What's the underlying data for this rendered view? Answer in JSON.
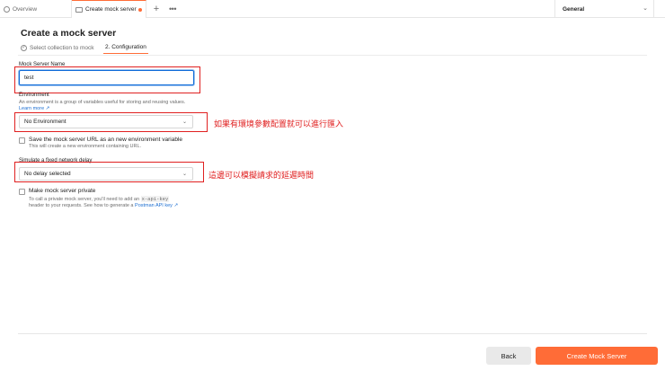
{
  "tabs": {
    "overview": "Overview",
    "create": "Create mock server",
    "add": "+",
    "more": "•••"
  },
  "environment_selector": {
    "value": "General"
  },
  "page": {
    "title": "Create a mock server",
    "steps": [
      "Select collection to mock",
      "2. Configuration"
    ]
  },
  "form": {
    "name_label": "Mock Server Name",
    "name_value": "test",
    "environment_label": "Environment",
    "environment_help": "An environment is a group of variables useful for storing and reusing values.",
    "learn_more": "Learn more ↗",
    "environment_value": "No Environment",
    "save_url_label": "Save the mock server URL as an new environment variable",
    "save_url_help": "This will create a new environment containing URL.",
    "delay_label": "Simulate a fixed network delay",
    "delay_value": "No delay selected",
    "private_label": "Make mock server private",
    "private_help_1": "To call a private mock server, you'll need to add an",
    "private_help_code": "x-api-key",
    "private_help_2": "header to your requests. See how to generate a",
    "private_help_link": "Postman API key ↗"
  },
  "annotations": {
    "environment_note": "如果有環境參數配置就可以進行匯入",
    "delay_note": "這邊可以模擬請求的延遲時間"
  },
  "footer": {
    "back": "Back",
    "create": "Create Mock Server"
  },
  "colors": {
    "accent": "#ff6c37",
    "annotation": "#e02020",
    "link": "#1d6fd1",
    "focus": "#0f6bd8"
  }
}
